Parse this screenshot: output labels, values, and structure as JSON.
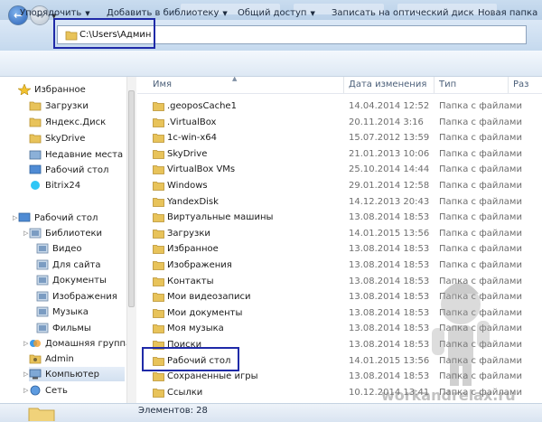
{
  "address": {
    "path": "C:\\Users\\Админ"
  },
  "toolbar": [
    {
      "label": "Упорядочить",
      "dropdown": true
    },
    {
      "label": "Добавить в библиотеку",
      "dropdown": true
    },
    {
      "label": "Общий доступ",
      "dropdown": true
    },
    {
      "label": "Записать на оптический диск",
      "dropdown": false
    },
    {
      "label": "Новая папка",
      "dropdown": false
    }
  ],
  "navpane": {
    "items": [
      {
        "label": "Избранное",
        "icon": "star-icon",
        "level": 0
      },
      {
        "label": "Загрузки",
        "icon": "folder-downloads-icon",
        "level": 1
      },
      {
        "label": "Яндекс.Диск",
        "icon": "folder-icon",
        "level": 1
      },
      {
        "label": "SkyDrive",
        "icon": "folder-icon",
        "level": 1
      },
      {
        "label": "Недавние места",
        "icon": "recent-places-icon",
        "level": 1
      },
      {
        "label": "Рабочий стол",
        "icon": "desktop-icon",
        "level": 1
      },
      {
        "label": "Bitrix24",
        "icon": "bitrix-icon",
        "level": 1
      },
      {
        "label": "Рабочий стол",
        "icon": "desktop-icon",
        "level": 0
      },
      {
        "label": "Библиотеки",
        "icon": "libraries-icon",
        "level": 1
      },
      {
        "label": "Видео",
        "icon": "video-library-icon",
        "level": 2
      },
      {
        "label": "Для сайта",
        "icon": "library-icon",
        "level": 2
      },
      {
        "label": "Документы",
        "icon": "documents-library-icon",
        "level": 2
      },
      {
        "label": "Изображения",
        "icon": "pictures-library-icon",
        "level": 2
      },
      {
        "label": "Музыка",
        "icon": "music-library-icon",
        "level": 2
      },
      {
        "label": "Фильмы",
        "icon": "movies-library-icon",
        "level": 2
      },
      {
        "label": "Домашняя группа",
        "icon": "homegroup-icon",
        "level": 1
      },
      {
        "label": "Admin",
        "icon": "user-folder-icon",
        "level": 1
      },
      {
        "label": "Компьютер",
        "icon": "computer-icon",
        "level": 1,
        "selected": true
      },
      {
        "label": "Сеть",
        "icon": "network-icon",
        "level": 1
      }
    ]
  },
  "columns": {
    "name": "Имя",
    "date": "Дата изменения",
    "type": "Тип",
    "size": "Раз"
  },
  "files": [
    {
      "name": ".geoposCache1",
      "date": "14.04.2014 12:52",
      "type": "Папка с файлами"
    },
    {
      "name": ".VirtualBox",
      "date": "20.11.2014 3:16",
      "type": "Папка с файлами"
    },
    {
      "name": "1c-win-x64",
      "date": "15.07.2012 13:59",
      "type": "Папка с файлами"
    },
    {
      "name": "SkyDrive",
      "date": "21.01.2013 10:06",
      "type": "Папка с файлами"
    },
    {
      "name": "VirtualBox VMs",
      "date": "25.10.2014 14:44",
      "type": "Папка с файлами"
    },
    {
      "name": "Windows",
      "date": "29.01.2014 12:58",
      "type": "Папка с файлами"
    },
    {
      "name": "YandexDisk",
      "date": "14.12.2013 20:43",
      "type": "Папка с файлами"
    },
    {
      "name": "Виртуальные машины",
      "date": "13.08.2014 18:53",
      "type": "Папка с файлами"
    },
    {
      "name": "Загрузки",
      "date": "14.01.2015 13:56",
      "type": "Папка с файлами"
    },
    {
      "name": "Избранное",
      "date": "13.08.2014 18:53",
      "type": "Папка с файлами"
    },
    {
      "name": "Изображения",
      "date": "13.08.2014 18:53",
      "type": "Папка с файлами"
    },
    {
      "name": "Контакты",
      "date": "13.08.2014 18:53",
      "type": "Папка с файлами"
    },
    {
      "name": "Мои видеозаписи",
      "date": "13.08.2014 18:53",
      "type": "Папка с файлами"
    },
    {
      "name": "Мои документы",
      "date": "13.08.2014 18:53",
      "type": "Папка с файлами"
    },
    {
      "name": "Моя музыка",
      "date": "13.08.2014 18:53",
      "type": "Папка с файлами"
    },
    {
      "name": "Поиски",
      "date": "13.08.2014 18:53",
      "type": "Папка с файлами"
    },
    {
      "name": "Рабочий стол",
      "date": "14.01.2015 13:56",
      "type": "Папка с файлами"
    },
    {
      "name": "Сохраненные игры",
      "date": "13.08.2014 18:53",
      "type": "Папка с файлами"
    },
    {
      "name": "Ссылки",
      "date": "10.12.2014 13:41",
      "type": "Папка с файлами"
    }
  ],
  "status": {
    "text": "Элементов: 28"
  },
  "watermark": "workandrelax.ru",
  "colors": {
    "highlight": "#1f2aa8",
    "folder": "#e8c35a",
    "selection": "#d2e0f0"
  }
}
